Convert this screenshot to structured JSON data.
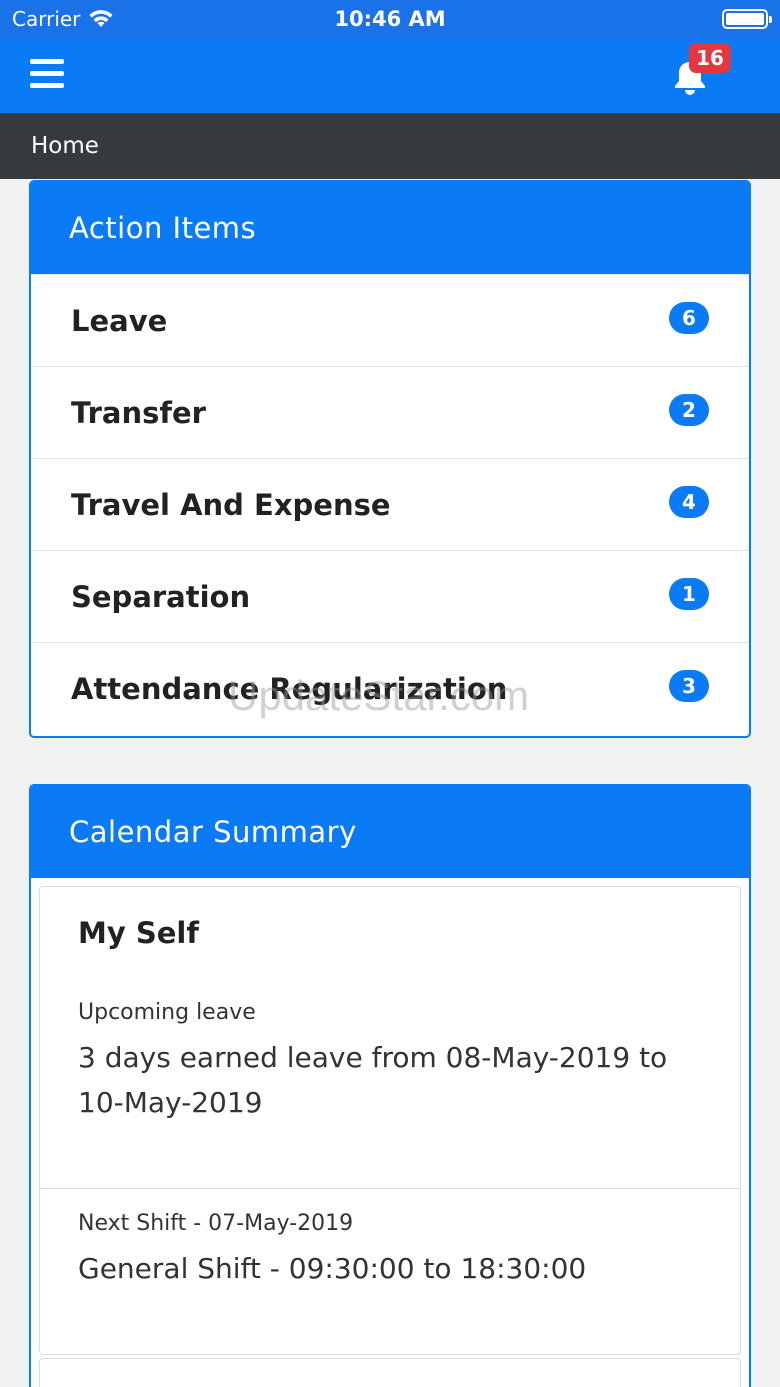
{
  "status_bar": {
    "carrier": "Carrier",
    "time": "10:46 AM"
  },
  "app_bar": {
    "notification_count": "16"
  },
  "breadcrumb": {
    "label": "Home"
  },
  "action_items": {
    "title": "Action Items",
    "items": [
      {
        "label": "Leave",
        "count": "6"
      },
      {
        "label": "Transfer",
        "count": "2"
      },
      {
        "label": "Travel And Expense",
        "count": "4"
      },
      {
        "label": "Separation",
        "count": "1"
      },
      {
        "label": "Attendance Regularization",
        "count": "3"
      }
    ]
  },
  "calendar_summary": {
    "title": "Calendar Summary",
    "section_title": "My Self",
    "entries": [
      {
        "label": "Upcoming leave",
        "value": "3 days earned leave from 08-May-2019 to 10-May-2019"
      },
      {
        "label": "Next Shift - 07-May-2019",
        "value": "General Shift - 09:30:00 to 18:30:00"
      }
    ]
  },
  "watermark": "UpdateStar.com",
  "colors": {
    "primary": "#0a7bf5",
    "status_bar": "#1a72e8",
    "breadcrumb": "#353a3f",
    "badge_red": "#e0383e"
  }
}
